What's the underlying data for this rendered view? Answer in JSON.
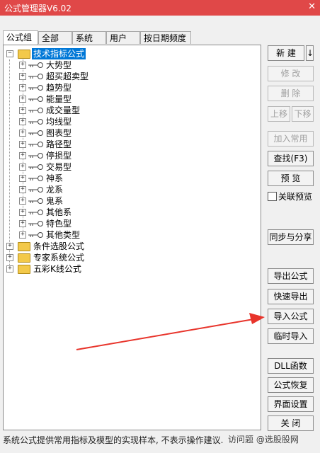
{
  "window": {
    "title": "公式管理器V6.02",
    "close_glyph": "✕"
  },
  "tabs": [
    {
      "label": "公式组",
      "active": true
    },
    {
      "label": "全部",
      "active": false
    },
    {
      "label": "系统",
      "active": false
    },
    {
      "label": "用户",
      "active": false
    },
    {
      "label": "按日期频度",
      "active": false
    }
  ],
  "tree": {
    "root": {
      "label": "技术指标公式",
      "expander": "−"
    },
    "children": [
      "大势型",
      "超买超卖型",
      "趋势型",
      "能量型",
      "成交量型",
      "均线型",
      "图表型",
      "路径型",
      "停损型",
      "交易型",
      "神系",
      "龙系",
      "鬼系",
      "其他系",
      "特色型",
      "其他类型"
    ],
    "groups": [
      "条件选股公式",
      "专家系统公式",
      "五彩K线公式"
    ],
    "expander_plus": "+"
  },
  "buttons": {
    "new": "新 建",
    "new_dropdown": "↓",
    "modify": "修 改",
    "delete": "删 除",
    "move_up": "上移",
    "move_down": "下移",
    "add_common": "加入常用",
    "find": "查找(F3)",
    "preview": "预 览",
    "link_preview_label": "关联预览",
    "sync_share": "同步与分享",
    "export": "导出公式",
    "quick_export": "快速导出",
    "import": "导入公式",
    "temp_import": "临时导入",
    "dll": "DLL函数",
    "restore": "公式恢复",
    "ui_settings": "界面设置",
    "close": "关 闭"
  },
  "status_text": "系统公式提供常用指标及模型的实现样本, 不表示操作建议.",
  "watermark": "访问题 @选股股网",
  "colors": {
    "titlebar": "#e04848",
    "selection": "#0078d7",
    "arrow": "#e8342b"
  }
}
